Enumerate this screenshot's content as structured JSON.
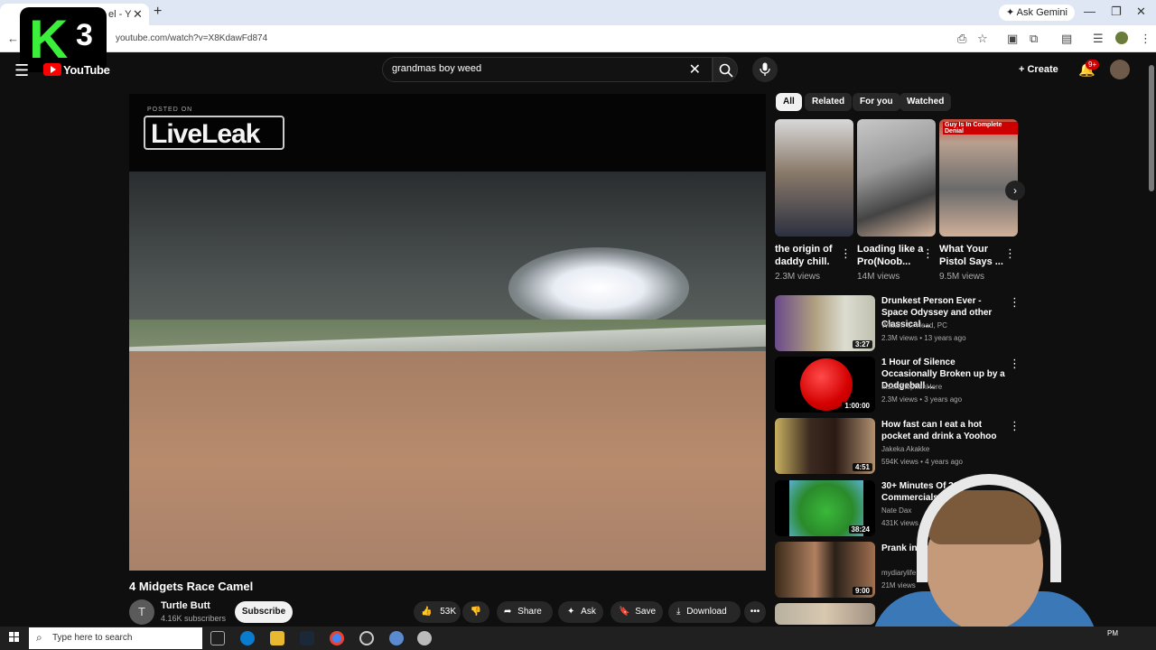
{
  "browser": {
    "tab_title": "el - Y",
    "url": "youtube.com/watch?v=X8KdawFd874",
    "ask_gemini": "Ask Gemini"
  },
  "overlay_logo": {
    "letter": "K",
    "number": "3"
  },
  "header": {
    "logo_text": "YouTube",
    "search_query": "grandmas boy weed",
    "create_label": "Create",
    "notif_badge": "9+"
  },
  "player": {
    "watermark_caption": "POSTED ON",
    "watermark_text": "LiveLeak"
  },
  "video": {
    "title": "4 Midgets Race Camel",
    "channel": {
      "initial": "T",
      "name": "Turtle Butt",
      "subscribers": "4.16K subscribers"
    },
    "subscribe_label": "Subscribe",
    "actions": {
      "likes": "53K",
      "share": "Share",
      "ask": "Ask",
      "save": "Save",
      "download": "Download"
    }
  },
  "chips": [
    "All",
    "Related",
    "For you",
    "Watched"
  ],
  "shorts": [
    {
      "title": "the origin of daddy chill.",
      "views": "2.3M views"
    },
    {
      "title": "Loading like a Pro(Noob...",
      "views": "14M views"
    },
    {
      "title": "What Your Pistol Says ...",
      "views": "9.5M views",
      "caption": "Guy Is In Complete Denial"
    }
  ],
  "recommendations": [
    {
      "title": "Drunkest Person Ever - Space Odyssey and other Classical ...",
      "channel": "William C. Head, PC",
      "meta": "2.3M views • 13 years ago",
      "duration": "3:27"
    },
    {
      "title": "1 Hour of Silence Occasionally Broken up by a Dodgeball ...",
      "channel": "InsertStephenHere",
      "meta": "2.3M views • 3 years ago",
      "duration": "1:00:00"
    },
    {
      "title": "How fast can I eat a hot pocket and drink a Yoohoo",
      "channel": "Jakeka Akakke",
      "meta": "594K views • 4 years ago",
      "duration": "4:51"
    },
    {
      "title": "30+ Minutes Of 200 Commercials",
      "channel": "Nate Dax",
      "meta": "431K views • 1",
      "duration": "38:24"
    },
    {
      "title": "Prank inter Wood",
      "channel": "mydiarylife",
      "meta": "21M views",
      "duration": "9:00"
    }
  ],
  "taskbar": {
    "search_placeholder": "Type here to search",
    "time": "PM"
  }
}
